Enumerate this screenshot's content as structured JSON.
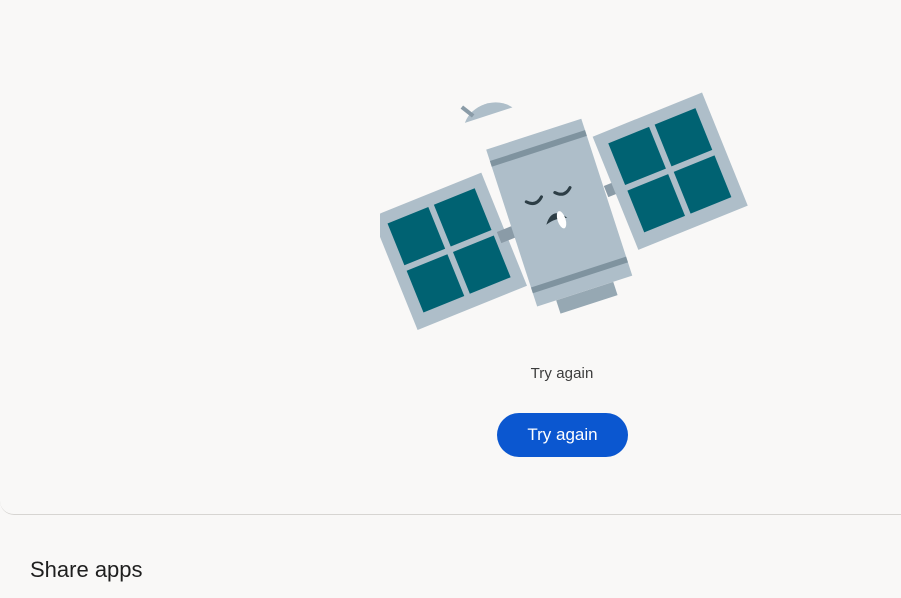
{
  "error_card": {
    "illustration": "sleeping-satellite-icon",
    "message": "Try again",
    "retry_button_label": "Try again"
  },
  "share_section": {
    "title": "Share apps"
  },
  "colors": {
    "background": "#f9f8f7",
    "accent": "#0b57d0",
    "panel_teal": "#006272",
    "satellite_gray": "#aebec9"
  }
}
